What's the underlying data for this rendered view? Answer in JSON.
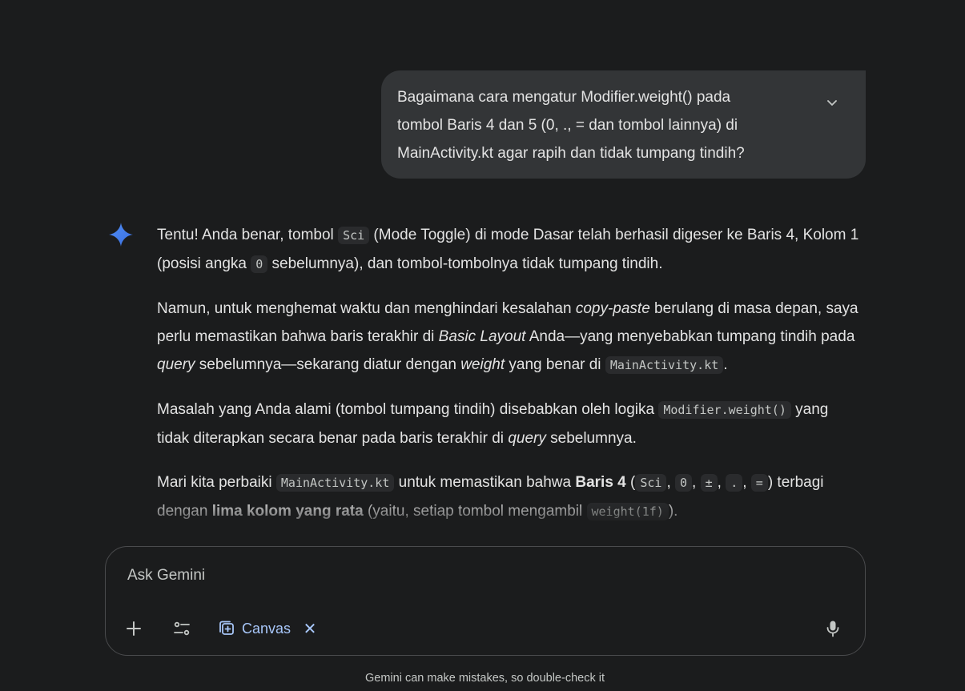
{
  "user_message": {
    "text": "Bagaimana cara mengatur Modifier.weight() pada\ntombol Baris 4 dan 5 (0, ., = dan tombol lainnya) di\nMainActivity.kt agar rapih dan tidak tumpang tindih?",
    "expand_icon": "chevron-down-icon"
  },
  "response": {
    "p1": {
      "t1": "Tentu! Anda benar, tombol ",
      "c1": "Sci",
      "t2": " (Mode Toggle) di mode Dasar telah berhasil digeser ke Baris 4, Kolom 1 (posisi angka ",
      "c2": "0",
      "t3": " sebelumnya), dan tombol-tombolnya tidak tumpang tindih."
    },
    "p2": {
      "t1": "Namun, untuk menghemat waktu dan menghindari kesalahan ",
      "i1": "copy-paste",
      "t2": " berulang di masa depan, saya perlu memastikan bahwa baris terakhir di ",
      "i2": "Basic Layout",
      "t3": " Anda—yang menyebabkan tumpang tindih pada ",
      "i3": "query",
      "t4": " sebelumnya—sekarang diatur dengan ",
      "i4": "weight",
      "t5": " yang benar di ",
      "c1": "MainActivity.kt",
      "t6": "."
    },
    "p3": {
      "t1": "Masalah yang Anda alami (tombol tumpang tindih) disebabkan oleh logika ",
      "c1": "Modifier.weight()",
      "t2": " yang tidak diterapkan secara benar pada baris terakhir di ",
      "i1": "query",
      "t3": " sebelumnya."
    },
    "p4": {
      "t1": "Mari kita perbaiki ",
      "c1": "MainActivity.kt",
      "t2": " untuk memastikan bahwa ",
      "b1": "Baris 4",
      "t3": " (",
      "c2": "Sci",
      "s1": ", ",
      "c3": "0",
      "s2": ", ",
      "c4": "±",
      "s3": ", ",
      "c5": ".",
      "s4": ", ",
      "c6": "=",
      "t4": ") terbagi dengan ",
      "b2": "lima kolom yang rata",
      "t5": " (yaitu, setiap tombol mengambil ",
      "c7": "weight(1f)",
      "t6": ")."
    }
  },
  "input": {
    "placeholder": "Ask Gemini",
    "value": "",
    "add_icon": "plus-icon",
    "tools_icon": "tune-icon",
    "canvas_label": "Canvas",
    "canvas_icon": "canvas-icon",
    "canvas_close": "✕",
    "mic_icon": "microphone-icon"
  },
  "disclaimer": "Gemini can make mistakes, so double-check it",
  "colors": {
    "background": "#1b1c1d",
    "bubble": "#333537",
    "accent": "#a8c7fa",
    "gemini_blue": "#4f8df5"
  }
}
